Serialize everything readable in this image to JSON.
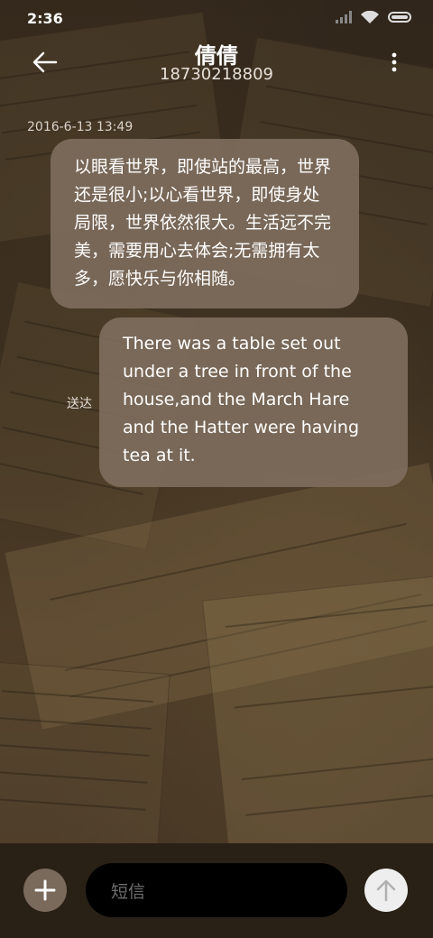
{
  "status_bar": {
    "time": "2:36",
    "icons": [
      "signal-icon",
      "wifi-icon",
      "battery-icon"
    ]
  },
  "header": {
    "contact_name": "倩倩",
    "contact_number": "18730218809",
    "back_icon": "back-arrow-icon",
    "more_icon": "more-vertical-icon"
  },
  "conversation": {
    "timestamp": "2016-6-13 13:49",
    "messages": [
      {
        "text": "以眼看世界，即使站的最高，世界还是很小;以心看世界，即使身处局限，世界依然很大。生活远不完美，需要用心去体会;无需拥有太多，愿快乐与你相随。"
      },
      {
        "text": "There was a table set out under a tree in front of the house,and the March Hare and the Hatter were having tea at it.",
        "status": "送达"
      }
    ]
  },
  "compose": {
    "placeholder": "短信",
    "add_icon": "plus-icon",
    "send_icon": "send-arrow-up-icon"
  },
  "colors": {
    "bubble": "#7e6c5c",
    "bottom_bar": "#2a2116",
    "input_bg": "#000000",
    "send_button": "#eeeeee"
  }
}
